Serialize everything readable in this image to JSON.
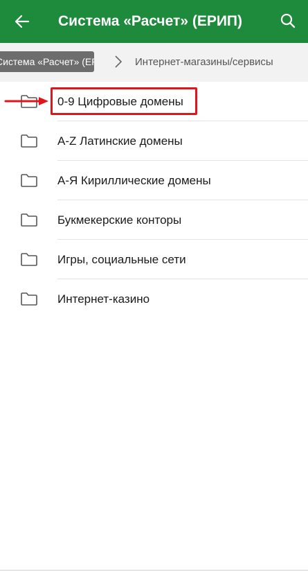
{
  "appbar": {
    "title": "Система «Расчет» (ЕРИП)",
    "back_icon": "arrow-left-icon",
    "search_icon": "search-icon",
    "color": "#1e8a3b"
  },
  "breadcrumb": {
    "parent": "Система «Расчет» (ЕРИП)",
    "current": "Интернет-магазины/сервисы"
  },
  "list": {
    "items": [
      {
        "label": "0-9 Цифровые домены",
        "icon": "folder-icon"
      },
      {
        "label": "A-Z Латинские домены",
        "icon": "folder-icon"
      },
      {
        "label": "А-Я Кириллические домены",
        "icon": "folder-icon"
      },
      {
        "label": "Букмекерские конторы",
        "icon": "folder-icon"
      },
      {
        "label": "Игры, социальные сети",
        "icon": "folder-icon"
      },
      {
        "label": "Интернет-казино",
        "icon": "folder-icon"
      }
    ]
  },
  "annotation": {
    "highlight_color": "#e0151b"
  }
}
